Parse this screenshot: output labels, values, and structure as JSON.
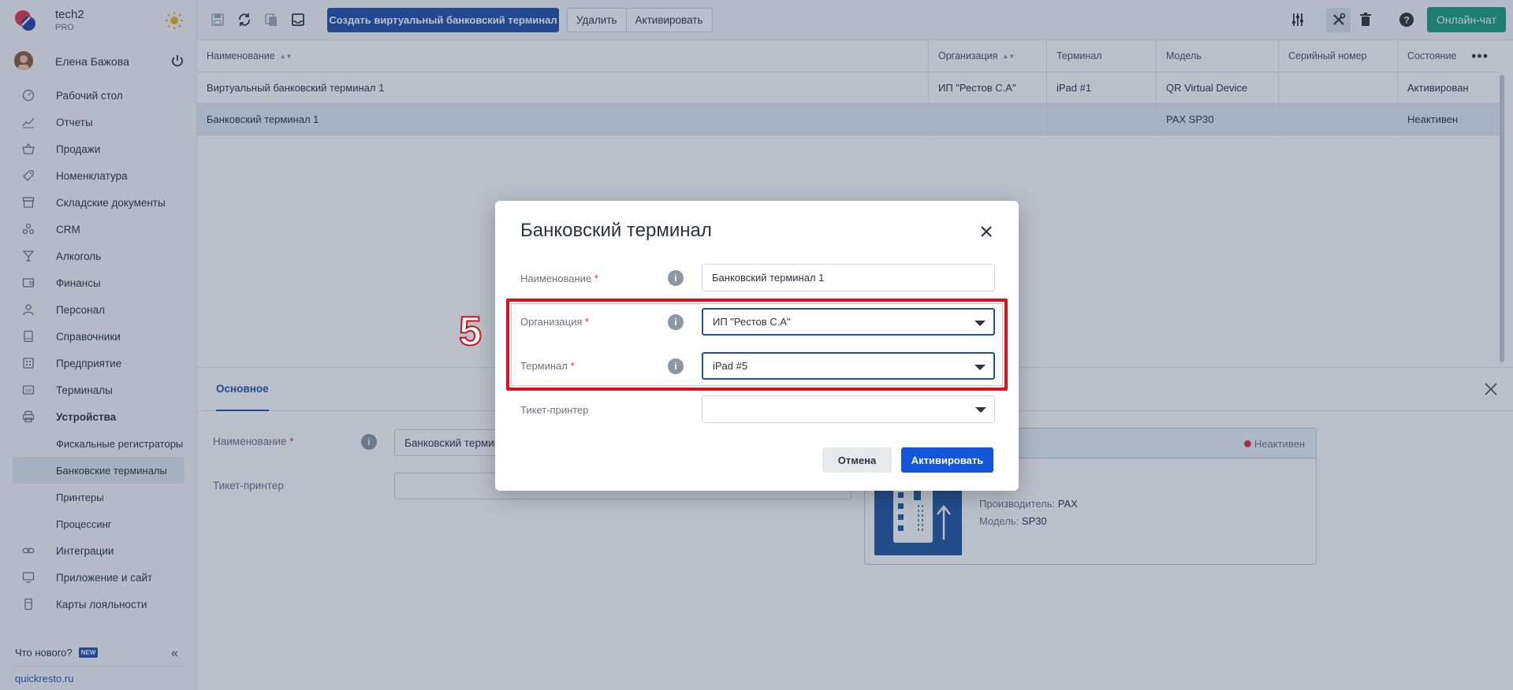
{
  "brand": {
    "name": "tech2",
    "plan": "PRO"
  },
  "user": {
    "name": "Елена Бажова"
  },
  "nav": [
    {
      "label": "Рабочий стол",
      "icon": "dashboard-icon"
    },
    {
      "label": "Отчеты",
      "icon": "chart-icon"
    },
    {
      "label": "Продажи",
      "icon": "basket-icon"
    },
    {
      "label": "Номенклатура",
      "icon": "tag-icon"
    },
    {
      "label": "Складские документы",
      "icon": "box-icon"
    },
    {
      "label": "CRM",
      "icon": "people-icon"
    },
    {
      "label": "Алкоголь",
      "icon": "glass-icon"
    },
    {
      "label": "Финансы",
      "icon": "wallet-icon"
    },
    {
      "label": "Персонал",
      "icon": "person-icon"
    },
    {
      "label": "Справочники",
      "icon": "book-icon"
    },
    {
      "label": "Предприятие",
      "icon": "building-icon"
    },
    {
      "label": "Терминалы",
      "icon": "terminal-icon"
    },
    {
      "label": "Устройства",
      "icon": "printer-icon"
    }
  ],
  "subnav": [
    {
      "label": "Фискальные регистраторы"
    },
    {
      "label": "Банковские терминалы"
    },
    {
      "label": "Принтеры"
    },
    {
      "label": "Процессинг"
    }
  ],
  "nav_bottom": [
    {
      "label": "Интеграции",
      "icon": "link-icon"
    },
    {
      "label": "Приложение и сайт",
      "icon": "monitor-icon"
    },
    {
      "label": "Карты лояльности",
      "icon": "card-icon"
    }
  ],
  "footer": {
    "whatsnew": "Что нового?",
    "badge": "NEW",
    "site": "quickresto.ru"
  },
  "toolbar": {
    "create_label": "Создать виртуальный банковский терминал",
    "delete_label": "Удалить",
    "activate_label": "Активировать",
    "chat_label": "Онлайн-чат"
  },
  "table": {
    "columns": [
      "Наименование",
      "Организация",
      "Терминал",
      "Модель",
      "Серийный номер",
      "Состояние"
    ],
    "rows": [
      [
        "Виртуальный банковский терминал 1",
        "ИП \"Рестов С.А\"",
        "iPad #1",
        "QR Virtual Device",
        "",
        "Активирован"
      ],
      [
        "Банковский терминал 1",
        "",
        "",
        "PAX SP30",
        "",
        "Неактивен"
      ]
    ]
  },
  "panel": {
    "tab": "Основное",
    "name_label": "Наименование",
    "name_value": "Банковский термин",
    "printer_label": "Тикет-принтер",
    "status": "Неактивен",
    "manufacturer_label": "Производитель:",
    "manufacturer_value": "PAX",
    "model_label": "Модель:",
    "model_value": "SP30"
  },
  "modal": {
    "title": "Банковский терминал",
    "name_label": "Наименование",
    "name_value": "Банковский терминал 1",
    "org_label": "Организация",
    "org_value": "ИП \"Рестов С.А\"",
    "terminal_label": "Терминал",
    "terminal_value": "iPad #5",
    "printer_label": "Тикет-принтер",
    "printer_value": "",
    "required_mark": "*",
    "cancel_label": "Отмена",
    "activate_label": "Активировать"
  },
  "annotation": {
    "step": "5"
  },
  "colors": {
    "accent": "#1f4fa8",
    "chat": "#1aa079",
    "highlight": "#e0101a"
  }
}
